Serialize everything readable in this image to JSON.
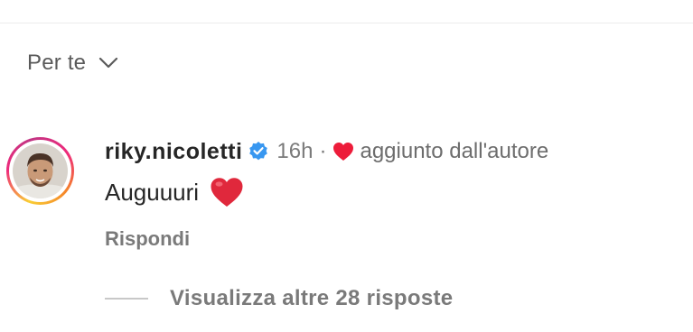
{
  "sort": {
    "label": "Per te",
    "icon": "chevron-down-icon"
  },
  "comment": {
    "username": "riky.nicoletti",
    "verified_icon": "verified-badge-icon",
    "time": "16h",
    "separator": "·",
    "liked_icon": "heart-icon",
    "liked_by_author": "aggiunto dall'autore",
    "text": "Auguuuri",
    "emoji_icon": "red-heart-emoji-icon",
    "reply_label": "Rispondi"
  },
  "replies": {
    "label": "Visualizza altre 28 risposte"
  },
  "colors": {
    "verified": "#3897f0",
    "heart": "#ed1c3a",
    "muted": "#7a7a7a",
    "text": "#262626"
  }
}
